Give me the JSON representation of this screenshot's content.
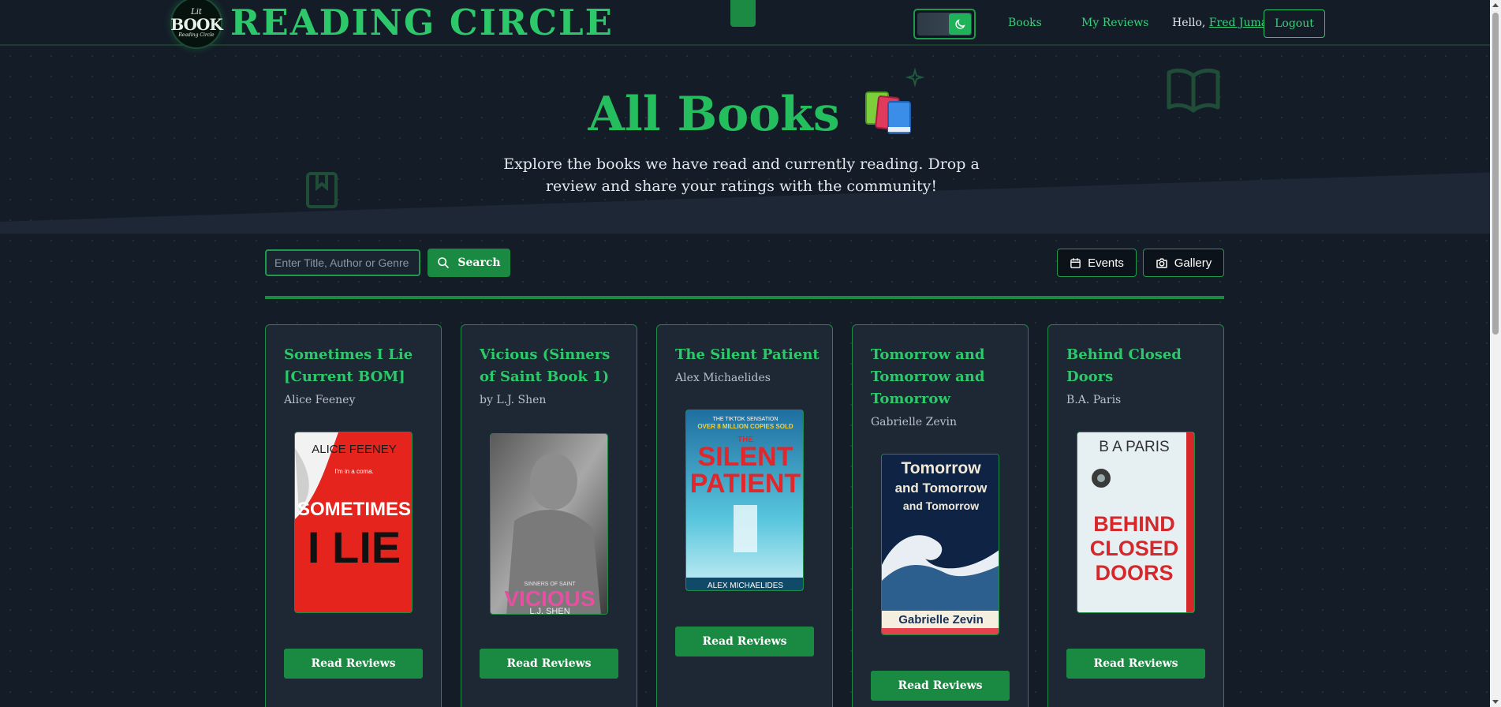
{
  "header": {
    "brand": "READING CIRCLE",
    "logo": {
      "line1": "Lit",
      "line2": "BOOK",
      "line3": "Reading Circle"
    },
    "nav": {
      "books": "Books",
      "my_reviews": "My Reviews"
    },
    "greeting": "Hello,",
    "user_name": "Fred Juma",
    "logout": "Logout",
    "theme_toggle_icon": "moon-icon"
  },
  "hero": {
    "title": "All Books",
    "emoji": "books-emoji",
    "subtitle": "Explore the books we have read and currently reading. Drop a review and share your ratings with the community!"
  },
  "toolbar": {
    "search_placeholder": "Enter Title, Author or Genre",
    "search_button": "Search",
    "events_button": "Events",
    "gallery_button": "Gallery"
  },
  "books": [
    {
      "title": "Sometimes I Lie [Current BOM]",
      "author": "Alice Feeney",
      "button": "Read Reviews",
      "cover": {
        "top": "ALICE FEENEY",
        "main1": "SOMETIMES",
        "main2": "I LIE",
        "tag": "I'm in a coma.",
        "bg": "#e8261f"
      }
    },
    {
      "title": "Vicious (Sinners of Saint Book 1)",
      "author": "by L.J. Shen",
      "button": "Read Reviews",
      "cover": {
        "top": "SINNERS OF SAINT",
        "main1": "VICIOUS",
        "main2": "L.J. SHEN",
        "bg": "#2b2b2b"
      }
    },
    {
      "title": "The Silent Patient",
      "author": "Alex Michaelides",
      "button": "Read Reviews",
      "cover": {
        "top": "THE TIKTOK SENSATION",
        "top2": "OVER 8 MILLION COPIES SOLD",
        "main0": "THE",
        "main1": "SILENT",
        "main2": "PATIENT",
        "bottom": "ALEX MICHAELIDES",
        "bg": "#3fb8cf"
      }
    },
    {
      "title": "Tomorrow and Tomorrow and Tomorrow",
      "author": "Gabrielle Zevin",
      "button": "Read Reviews",
      "cover": {
        "main1": "Tomorrow",
        "main2": "and Tomorrow",
        "main3": "and Tomorrow",
        "bottom": "Gabrielle Zevin",
        "bg": "#0d1f3a"
      }
    },
    {
      "title": "Behind Closed Doors",
      "author": "B.A. Paris",
      "button": "Read Reviews",
      "cover": {
        "top": "B A PARIS",
        "main1": "BEHIND",
        "main2": "CLOSED",
        "main3": "DOORS",
        "bg": "#e9f1f3"
      }
    }
  ],
  "colors": {
    "accent": "#2cc86a",
    "button": "#1a8a42",
    "background": "#141c27",
    "card": "#1e2834"
  }
}
